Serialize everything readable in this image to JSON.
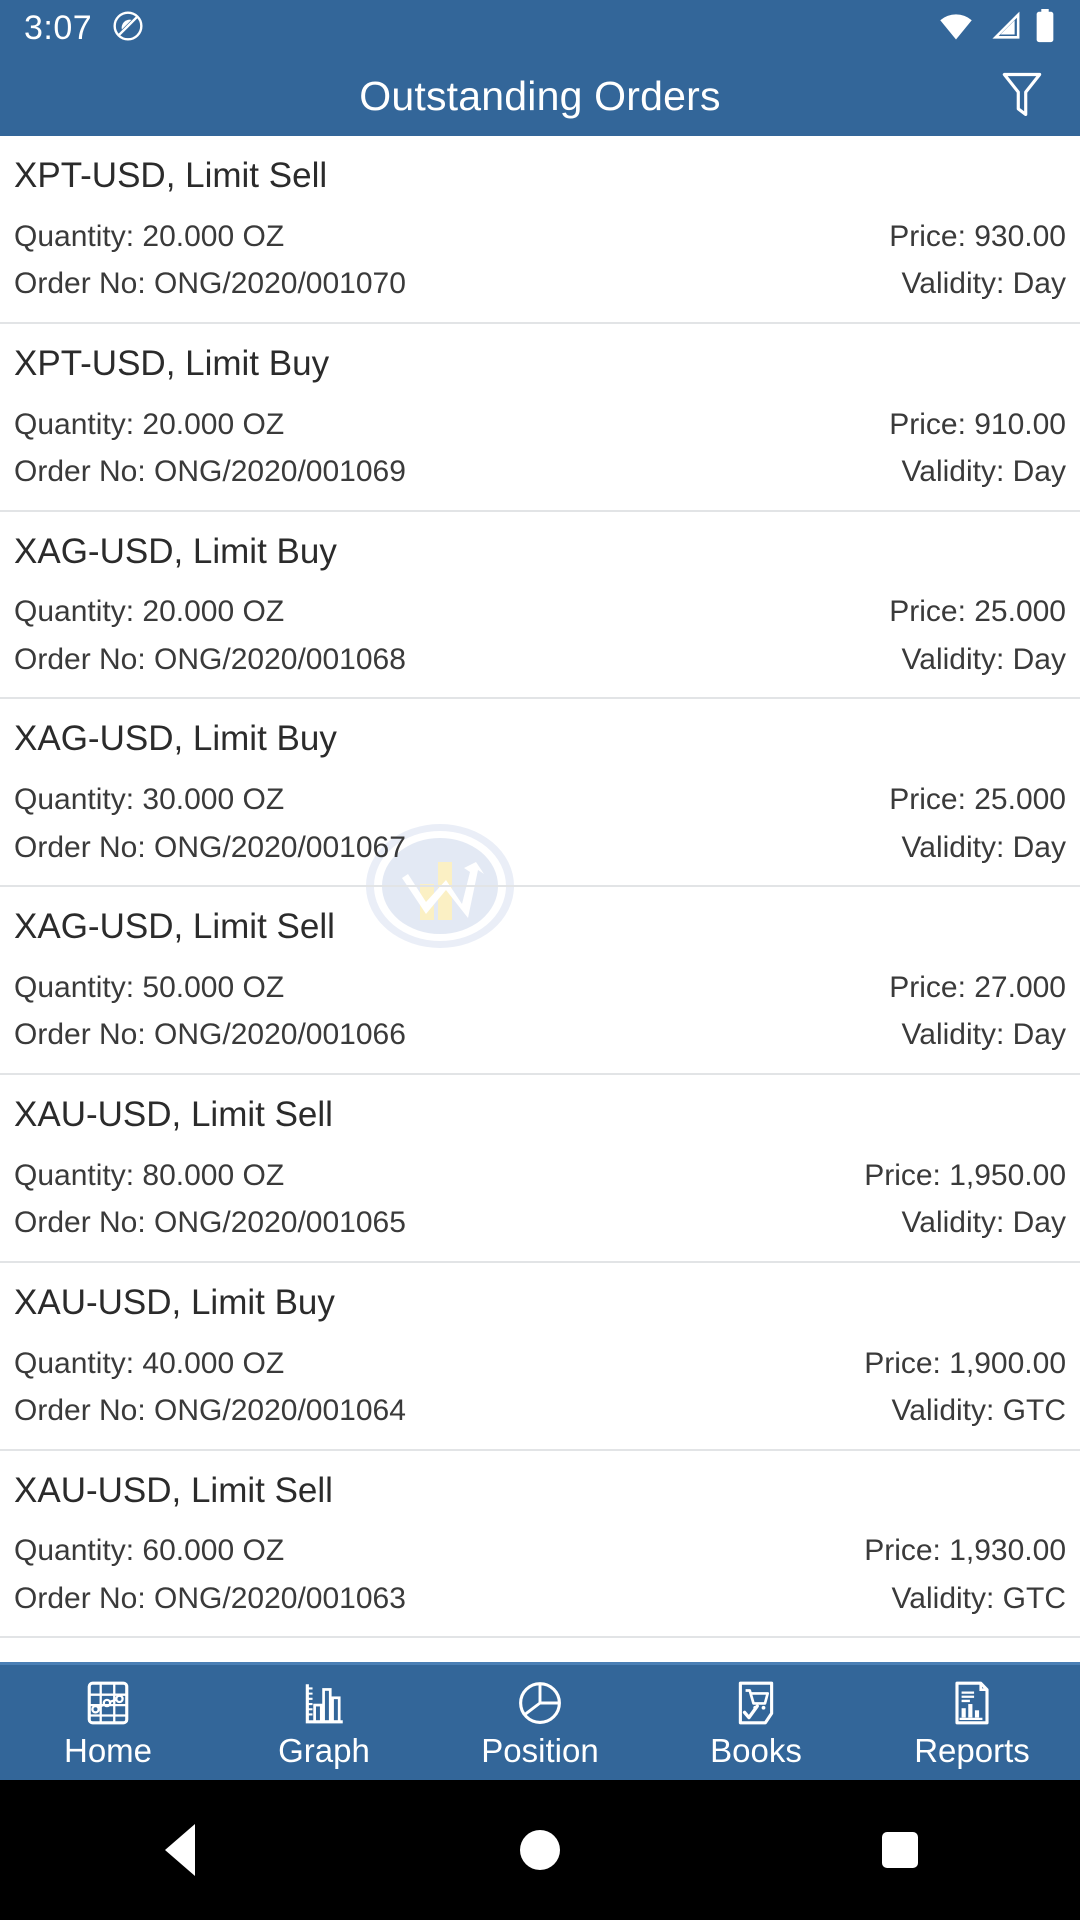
{
  "status_bar": {
    "time": "3:07",
    "icons": [
      "dnd-icon",
      "wifi-icon",
      "cellular-signal-icon",
      "battery-icon"
    ]
  },
  "app_bar": {
    "title": "Outstanding Orders",
    "filter_icon": "filter-icon"
  },
  "labels": {
    "quantity_prefix": "Quantity: ",
    "price_prefix": "Price: ",
    "order_no_prefix": "Order No: ",
    "validity_prefix": "Validity: "
  },
  "orders": [
    {
      "title": "XPT-USD, Limit Sell",
      "quantity": "Quantity: 20.000 OZ",
      "price": "Price: 930.00",
      "order_no": "Order No: ONG/2020/001070",
      "validity": "Validity: Day"
    },
    {
      "title": "XPT-USD, Limit Buy",
      "quantity": "Quantity: 20.000 OZ",
      "price": "Price: 910.00",
      "order_no": "Order No: ONG/2020/001069",
      "validity": "Validity: Day"
    },
    {
      "title": "XAG-USD, Limit Buy",
      "quantity": "Quantity: 20.000 OZ",
      "price": "Price: 25.000",
      "order_no": "Order No: ONG/2020/001068",
      "validity": "Validity: Day"
    },
    {
      "title": "XAG-USD, Limit Buy",
      "quantity": "Quantity: 30.000 OZ",
      "price": "Price: 25.000",
      "order_no": "Order No: ONG/2020/001067",
      "validity": "Validity: Day"
    },
    {
      "title": "XAG-USD, Limit Sell",
      "quantity": "Quantity: 50.000 OZ",
      "price": "Price: 27.000",
      "order_no": "Order No: ONG/2020/001066",
      "validity": "Validity: Day"
    },
    {
      "title": "XAU-USD, Limit Sell",
      "quantity": "Quantity: 80.000 OZ",
      "price": "Price: 1,950.00",
      "order_no": "Order No: ONG/2020/001065",
      "validity": "Validity: Day"
    },
    {
      "title": "XAU-USD, Limit Buy",
      "quantity": "Quantity: 40.000 OZ",
      "price": "Price: 1,900.00",
      "order_no": "Order No: ONG/2020/001064",
      "validity": "Validity: GTC"
    },
    {
      "title": "XAU-USD, Limit Sell",
      "quantity": "Quantity: 60.000 OZ",
      "price": "Price: 1,930.00",
      "order_no": "Order No: ONG/2020/001063",
      "validity": "Validity: GTC"
    }
  ],
  "bottom_nav": {
    "items": [
      {
        "label": "Home",
        "icon": "grid-table-icon"
      },
      {
        "label": "Graph",
        "icon": "bar-chart-icon"
      },
      {
        "label": "Position",
        "icon": "pie-chart-icon"
      },
      {
        "label": "Books",
        "icon": "order-book-cart-icon"
      },
      {
        "label": "Reports",
        "icon": "report-document-icon"
      }
    ]
  },
  "android_nav": {
    "back": "back-triangle-icon",
    "home": "home-circle-icon",
    "recents": "recents-square-icon"
  },
  "theme": {
    "primary": "#336699",
    "primary_dark": "#2f6097",
    "text": "#2b2b2b",
    "text_secondary": "#3a3a3a",
    "divider": "#e2e4e6",
    "surface": "#ffffff",
    "on_primary": "#ffffff",
    "watermark_blue": "#dfe5f2",
    "watermark_yellow": "#fbf0c4",
    "nav_bar_black": "#000000"
  }
}
